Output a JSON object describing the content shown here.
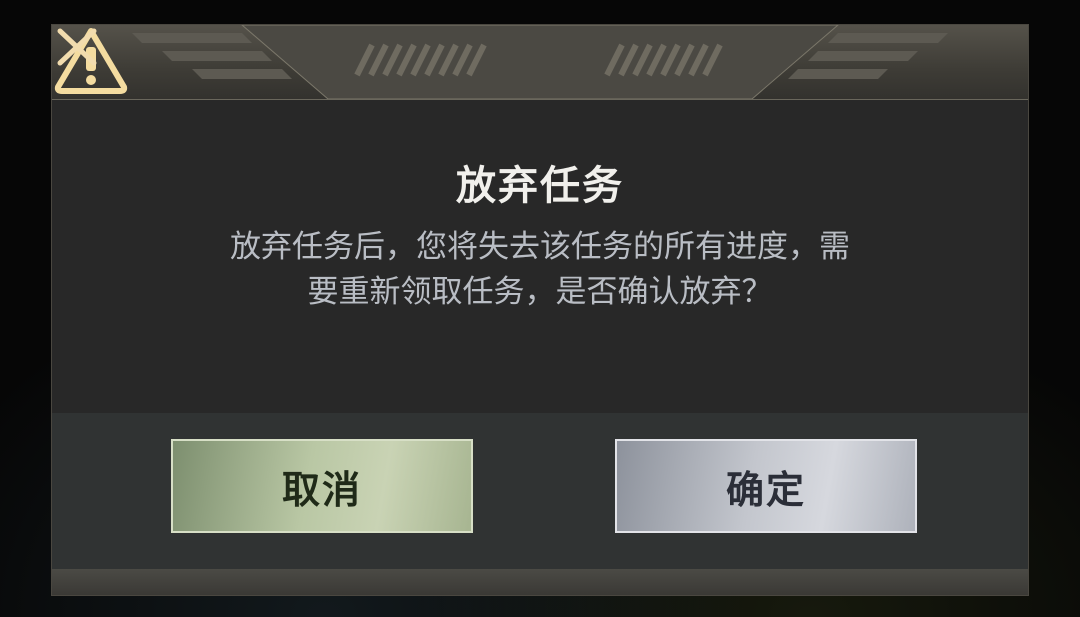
{
  "dialog": {
    "title": "放弃任务",
    "message": "放弃任务后，您将失去该任务的所有进度，需要重新领取任务，是否确认放弃？",
    "cancel_label": "取消",
    "confirm_label": "确定"
  },
  "icons": {
    "header": "warning-triangle-icon",
    "close": "close-x-icon"
  },
  "colors": {
    "panel": "#282828",
    "accent_gold": "#f4dca0",
    "cancel_button": "#b9c7a4",
    "confirm_button": "#c3c6cd"
  }
}
